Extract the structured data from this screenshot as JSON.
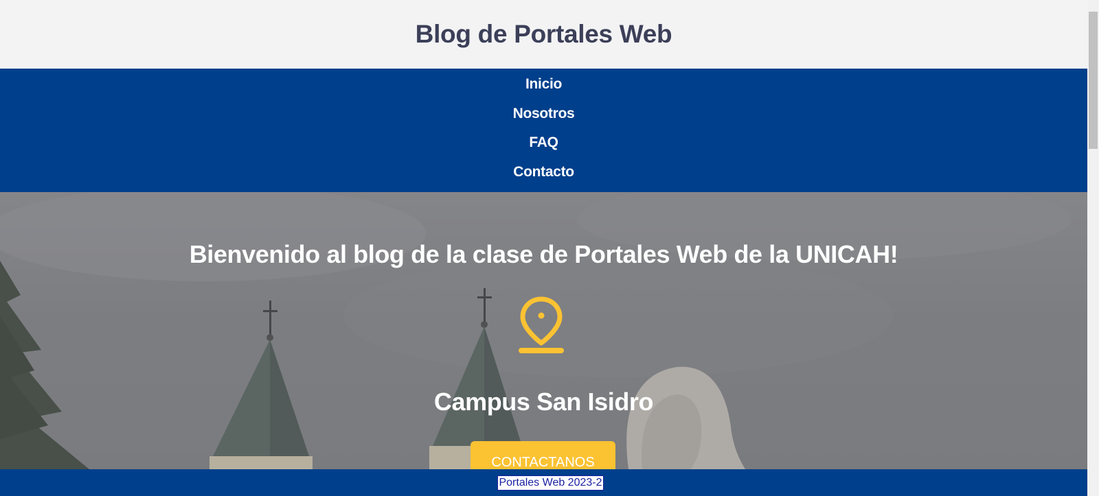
{
  "header": {
    "title": "Blog de Portales Web"
  },
  "nav": {
    "items": [
      {
        "label": "Inicio"
      },
      {
        "label": "Nosotros"
      },
      {
        "label": "FAQ"
      },
      {
        "label": "Contacto"
      }
    ]
  },
  "hero": {
    "title": "Bienvenido al blog de la clase de Portales Web de la UNICAH!",
    "icon": "map-pin-icon",
    "campus": "Campus San Isidro",
    "cta_label": "CONTACTANOS"
  },
  "footer": {
    "text": "Portales Web 2023-2"
  },
  "colors": {
    "primary": "#003f8b",
    "accent": "#fbc232",
    "title_text": "#3c3f58",
    "header_bg": "#f3f3f4"
  }
}
